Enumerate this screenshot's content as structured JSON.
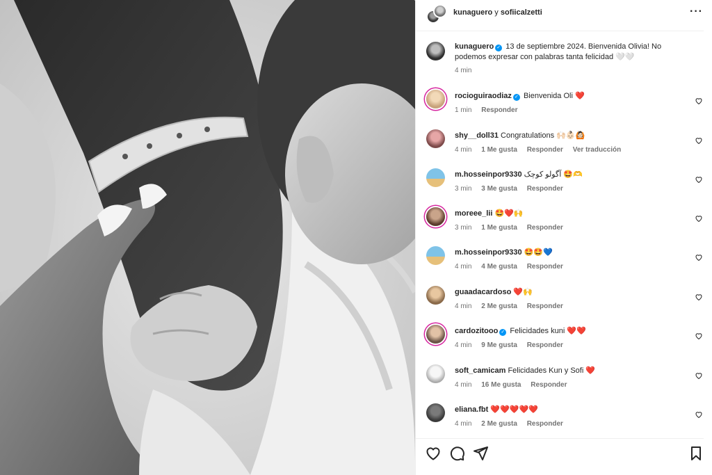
{
  "post": {
    "photo": {
      "description_icon": "newborn-hand-photo"
    },
    "header": {
      "user1": "kunaguero",
      "joiner": " y ",
      "user2": "sofiicalzetti",
      "more_icon": "more-horizontal-icon"
    },
    "caption": {
      "username": "kunaguero",
      "text": "13 de septiembre 2024. Bienvenida Olivia! No podemos expresar con palabras tanta felicidad 🤍🤍",
      "time": "4 min"
    },
    "comments": [
      {
        "username": "rocioguiraodiaz",
        "verified": true,
        "text": "Bienvenida Oli ❤️",
        "time": "1 min",
        "likes": "",
        "reply": "Responder",
        "translate": "",
        "ring": true
      },
      {
        "username": "shy__doll31",
        "verified": false,
        "text": "Congratulations 🙌🏻👶🏻🙆🏻",
        "time": "4 min",
        "likes": "1 Me gusta",
        "reply": "Responder",
        "translate": "Ver traducción",
        "ring": false
      },
      {
        "username": "m.hosseinpor9330",
        "verified": false,
        "text": "آگولو کوچک 🤩🫶",
        "time": "3 min",
        "likes": "3 Me gusta",
        "reply": "Responder",
        "translate": "",
        "ring": false
      },
      {
        "username": "moreee_lii",
        "verified": false,
        "text": "🤩❤️🙌",
        "time": "3 min",
        "likes": "1 Me gusta",
        "reply": "Responder",
        "translate": "",
        "ring": true
      },
      {
        "username": "m.hosseinpor9330",
        "verified": false,
        "text": "🤩🤩💙",
        "time": "4 min",
        "likes": "4 Me gusta",
        "reply": "Responder",
        "translate": "",
        "ring": false
      },
      {
        "username": "guaadacardoso",
        "verified": false,
        "text": "❤️🙌",
        "time": "4 min",
        "likes": "2 Me gusta",
        "reply": "Responder",
        "translate": "",
        "ring": false
      },
      {
        "username": "cardozitooo",
        "verified": true,
        "text": "Felicidades kuni ❤️❤️",
        "time": "4 min",
        "likes": "9 Me gusta",
        "reply": "Responder",
        "translate": "",
        "ring": true
      },
      {
        "username": "soft_camicam",
        "verified": false,
        "text": "Felicidades Kun y Sofi ❤️",
        "time": "4 min",
        "likes": "16 Me gusta",
        "reply": "Responder",
        "translate": "",
        "ring": false
      },
      {
        "username": "eliana.fbt",
        "verified": false,
        "text": "❤️❤️❤️❤️❤️",
        "time": "4 min",
        "likes": "2 Me gusta",
        "reply": "Responder",
        "translate": "",
        "ring": false
      }
    ],
    "actions": {
      "like_icon": "heart-outline-icon",
      "comment_icon": "comment-icon",
      "share_icon": "paper-plane-icon",
      "save_icon": "bookmark-icon"
    }
  }
}
